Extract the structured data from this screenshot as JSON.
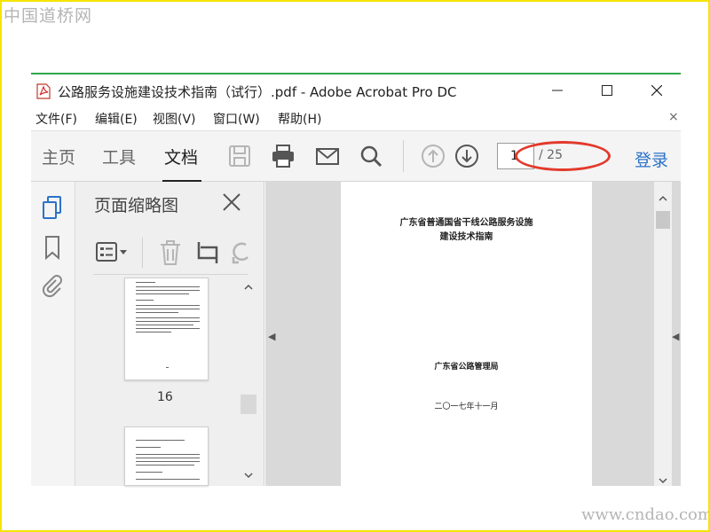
{
  "watermarks": {
    "top": "中国道桥网",
    "bottom": "www.cndao.com"
  },
  "window": {
    "title": "公路服务设施建设技术指南（试行）.pdf - Adobe Acrobat Pro DC",
    "controls": {
      "minimize": "—",
      "maximize": "☐",
      "close": "✕"
    }
  },
  "menu": {
    "items": [
      "文件(F)",
      "编辑(E)",
      "视图(V)",
      "窗口(W)",
      "帮助(H)"
    ],
    "close": "×"
  },
  "toolbar": {
    "tabs": [
      "主页",
      "工具",
      "文档"
    ],
    "active_tab": "文档",
    "icons": [
      "save-icon",
      "print-icon",
      "email-icon",
      "search-icon",
      "prev-page-icon",
      "next-page-icon"
    ],
    "page_current": "1",
    "page_total": "/ 25",
    "login": "登录"
  },
  "left_bar": {
    "icons": [
      "page-thumbnails-icon",
      "bookmark-icon",
      "attachment-icon"
    ]
  },
  "thumbnail_panel": {
    "title": "页面缩略图",
    "tools": [
      "options-menu-icon",
      "delete-icon",
      "crop-icon",
      "undo-icon"
    ],
    "page_label": "16"
  },
  "document": {
    "title_line1": "广东省普通国省干线公路服务设施",
    "title_line2": "建设技术指南",
    "issuer": "广东省公路管理局",
    "date": "二〇一七年十一月"
  },
  "colors": {
    "accent_link": "#2b72c8",
    "highlight_ellipse": "#e23a2c",
    "frame_border": "#f5e400",
    "title_rule": "#2fa84a"
  }
}
